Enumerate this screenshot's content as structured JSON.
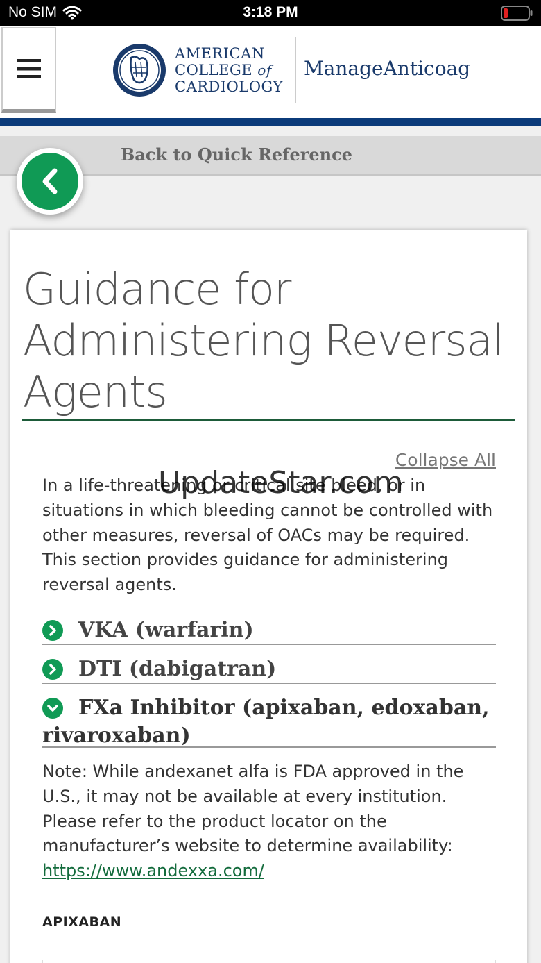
{
  "status_bar": {
    "carrier": "No SIM",
    "time": "3:18 PM"
  },
  "header": {
    "org_line1": "AMERICAN",
    "org_line2_a": "COLLEGE",
    "org_line2_b": "of",
    "org_line3": "CARDIOLOGY",
    "product": "ManageAnticoag"
  },
  "nav": {
    "back_label": "Back to Quick Reference"
  },
  "page": {
    "title": "Guidance for Administering Reversal Agents",
    "collapse_all": "Collapse All",
    "watermark": "UpdateStar.com",
    "intro": "In a life-threatening or critical site bleed, or in situations in which bleeding cannot be controlled with other measures, reversal of OACs may be required. This section provides guidance for administering reversal agents.",
    "sections": [
      {
        "label": "VKA (warfarin)",
        "state": "collapsed"
      },
      {
        "label": "DTI (dabigatran)",
        "state": "collapsed"
      },
      {
        "label": "FXa Inhibitor (apixaban, edoxaban, rivaroxaban)",
        "state": "expanded"
      }
    ],
    "note_text": "Note: While andexanet alfa is FDA approved in the U.S., it may not be available at every institution. Please refer to the product locator on the manufacturer’s website to determine availability: ",
    "note_link": "https://www.andexxa.com/",
    "subheading": "APIXABAN"
  },
  "colors": {
    "accent_green": "#109a55",
    "brand_navy": "#0b3b7a",
    "link_green": "#136b3c"
  }
}
